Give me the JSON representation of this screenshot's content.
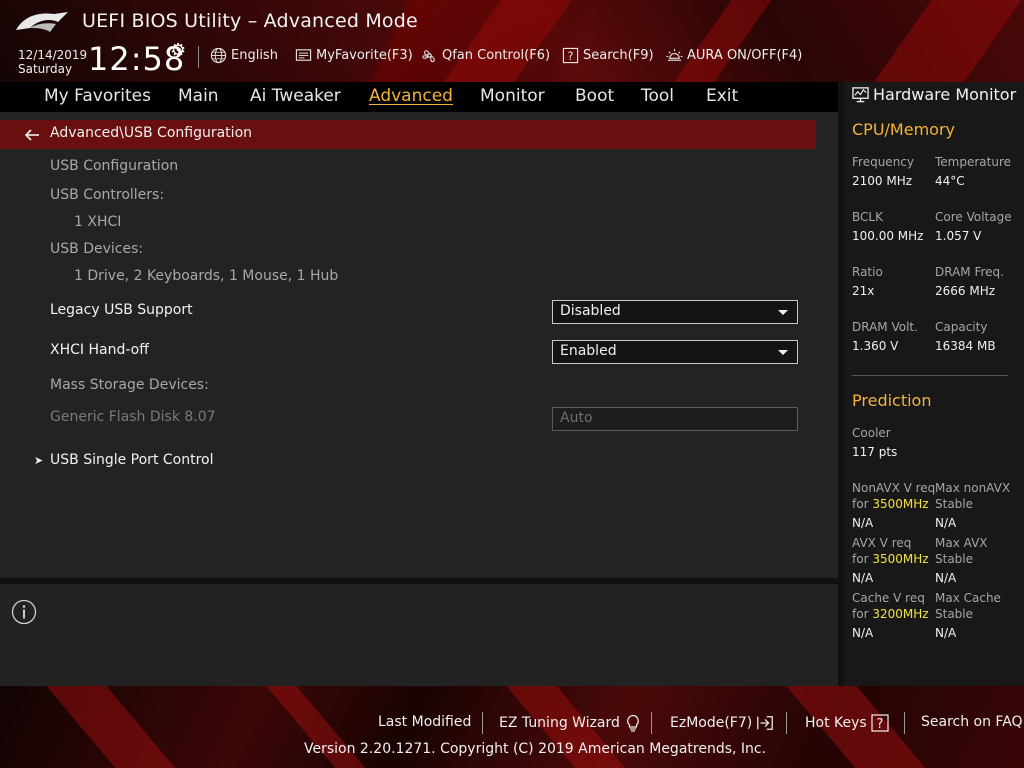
{
  "header": {
    "title": "UEFI BIOS Utility – Advanced Mode",
    "date": "12/14/2019",
    "day": "Saturday",
    "time": "12:58",
    "tools": {
      "language": "English",
      "myfavorite": "MyFavorite(F3)",
      "qfan": "Qfan Control(F6)",
      "search": "Search(F9)",
      "aura": "AURA ON/OFF(F4)"
    },
    "icons": [
      "rog-logo",
      "gear-icon",
      "globe-icon",
      "myfavorite-icon",
      "fan-icon",
      "search-help-icon",
      "aura-icon"
    ]
  },
  "nav": {
    "tabs": [
      "My Favorites",
      "Main",
      "Ai Tweaker",
      "Advanced",
      "Monitor",
      "Boot",
      "Tool",
      "Exit"
    ],
    "active": "Advanced"
  },
  "main": {
    "breadcrumb": "Advanced\\USB Configuration",
    "usb_configuration": "USB Configuration",
    "usb_controllers_label": "USB Controllers:",
    "usb_controllers_value": "1 XHCI",
    "usb_devices_label": "USB Devices:",
    "usb_devices_value": "1 Drive, 2 Keyboards, 1 Mouse, 1 Hub",
    "legacy_usb": {
      "label": "Legacy USB Support",
      "value": "Disabled"
    },
    "xhci_handoff": {
      "label": "XHCI Hand-off",
      "value": "Enabled"
    },
    "mass_storage_label": "Mass Storage Devices:",
    "flash_disk": {
      "label": "Generic Flash Disk 8.07",
      "value": "Auto"
    },
    "usb_single_port": "USB Single Port Control"
  },
  "hardware_monitor": {
    "title": "Hardware Monitor",
    "cpu_memory": {
      "title": "CPU/Memory",
      "frequency": {
        "label": "Frequency",
        "value": "2100 MHz"
      },
      "temperature": {
        "label": "Temperature",
        "value": "44°C"
      },
      "bclk": {
        "label": "BCLK",
        "value": "100.00 MHz"
      },
      "core_voltage": {
        "label": "Core Voltage",
        "value": "1.057 V"
      },
      "ratio": {
        "label": "Ratio",
        "value": "21x"
      },
      "dram_freq": {
        "label": "DRAM Freq.",
        "value": "2666 MHz"
      },
      "dram_volt": {
        "label": "DRAM Volt.",
        "value": "1.360 V"
      },
      "capacity": {
        "label": "Capacity",
        "value": "16384 MB"
      }
    },
    "prediction": {
      "title": "Prediction",
      "cooler": {
        "label": "Cooler",
        "value": "117 pts"
      },
      "nonavx_req": {
        "label1": "NonAVX V req",
        "label2": "for",
        "freq": "3500MHz",
        "value": "N/A"
      },
      "max_nonavx": {
        "label1": "Max nonAVX",
        "label2": "Stable",
        "value": "N/A"
      },
      "avx_req": {
        "label1": "AVX V req",
        "label2": "for",
        "freq": "3500MHz",
        "value": "N/A"
      },
      "max_avx": {
        "label1": "Max AVX",
        "label2": "Stable",
        "value": "N/A"
      },
      "cache_req": {
        "label1": "Cache V req",
        "label2": "for",
        "freq": "3200MHz",
        "value": "N/A"
      },
      "max_cache": {
        "label1": "Max Cache",
        "label2": "Stable",
        "value": "N/A"
      }
    }
  },
  "footer": {
    "last_modified": "Last Modified",
    "ez_tuning": "EZ Tuning Wizard",
    "ezmode": "EzMode(F7)",
    "hotkeys": "Hot Keys",
    "search_faq": "Search on FAQ",
    "copyright": "Version 2.20.1271. Copyright (C) 2019 American Megatrends, Inc."
  },
  "colors": {
    "accent": "#f3b23a",
    "highlight": "#f3e23a",
    "breadcrumb_bg": "#6a0f0f",
    "panel_bg": "#232323"
  }
}
